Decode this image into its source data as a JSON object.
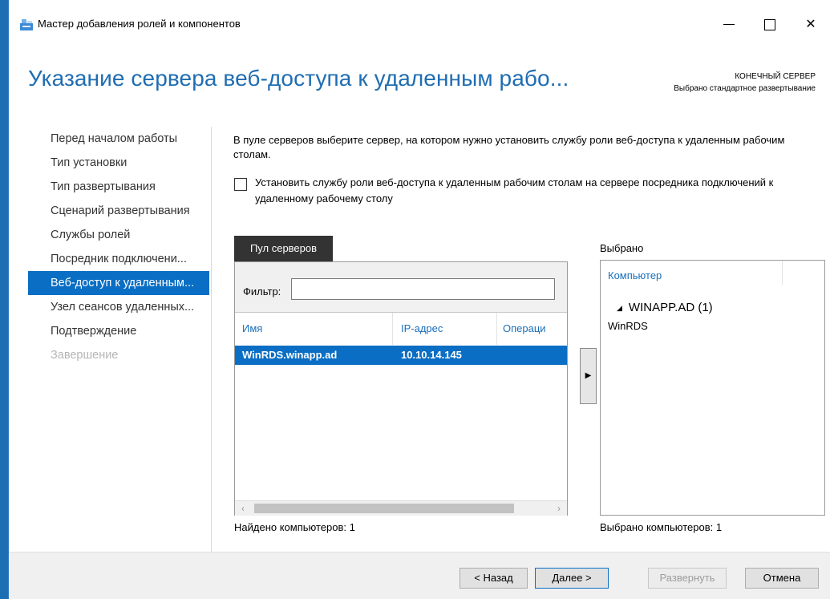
{
  "window": {
    "title": "Мастер добавления ролей и компонентов"
  },
  "header": {
    "page_title": "Указание сервера веб-доступа к удаленным рабо...",
    "dest_label": "КОНЕЧНЫЙ СЕРВЕР",
    "dest_value": "Выбрано стандартное развертывание"
  },
  "nav": {
    "items": [
      {
        "label": "Перед началом работы",
        "state": "normal"
      },
      {
        "label": "Тип установки",
        "state": "normal"
      },
      {
        "label": "Тип развертывания",
        "state": "normal"
      },
      {
        "label": "Сценарий развертывания",
        "state": "normal"
      },
      {
        "label": "Службы ролей",
        "state": "normal"
      },
      {
        "label": "Посредник подключени...",
        "state": "normal"
      },
      {
        "label": "Веб-доступ к удаленным...",
        "state": "active"
      },
      {
        "label": "Узел сеансов удаленных...",
        "state": "normal"
      },
      {
        "label": "Подтверждение",
        "state": "normal"
      },
      {
        "label": "Завершение",
        "state": "disabled"
      }
    ]
  },
  "content": {
    "description": "В пуле серверов выберите сервер, на котором нужно установить службу роли веб-доступа к удаленным рабочим столам.",
    "checkbox_label": "Установить службу роли веб-доступа к удаленным рабочим столам на сервере посредника подключений к удаленному рабочему столу",
    "checkbox_checked": false
  },
  "pool": {
    "tab_label": "Пул серверов",
    "filter_label": "Фильтр:",
    "filter_value": "",
    "columns": [
      "Имя",
      "IP-адрес",
      "Операци"
    ],
    "rows": [
      {
        "name": "WinRDS.winapp.ad",
        "ip": "10.10.14.145",
        "os": ""
      }
    ],
    "found_text": "Найдено компьютеров: 1"
  },
  "selected": {
    "label": "Выбрано",
    "column": "Компьютер",
    "group": "WINAPP.AD (1)",
    "items": [
      "WinRDS"
    ],
    "count_text": "Выбрано компьютеров: 1"
  },
  "buttons": {
    "back": "< Назад",
    "next": "Далее >",
    "deploy": "Развернуть",
    "cancel": "Отмена"
  },
  "colors": {
    "accent": "#0a6ec4",
    "title": "#1f6db2"
  }
}
